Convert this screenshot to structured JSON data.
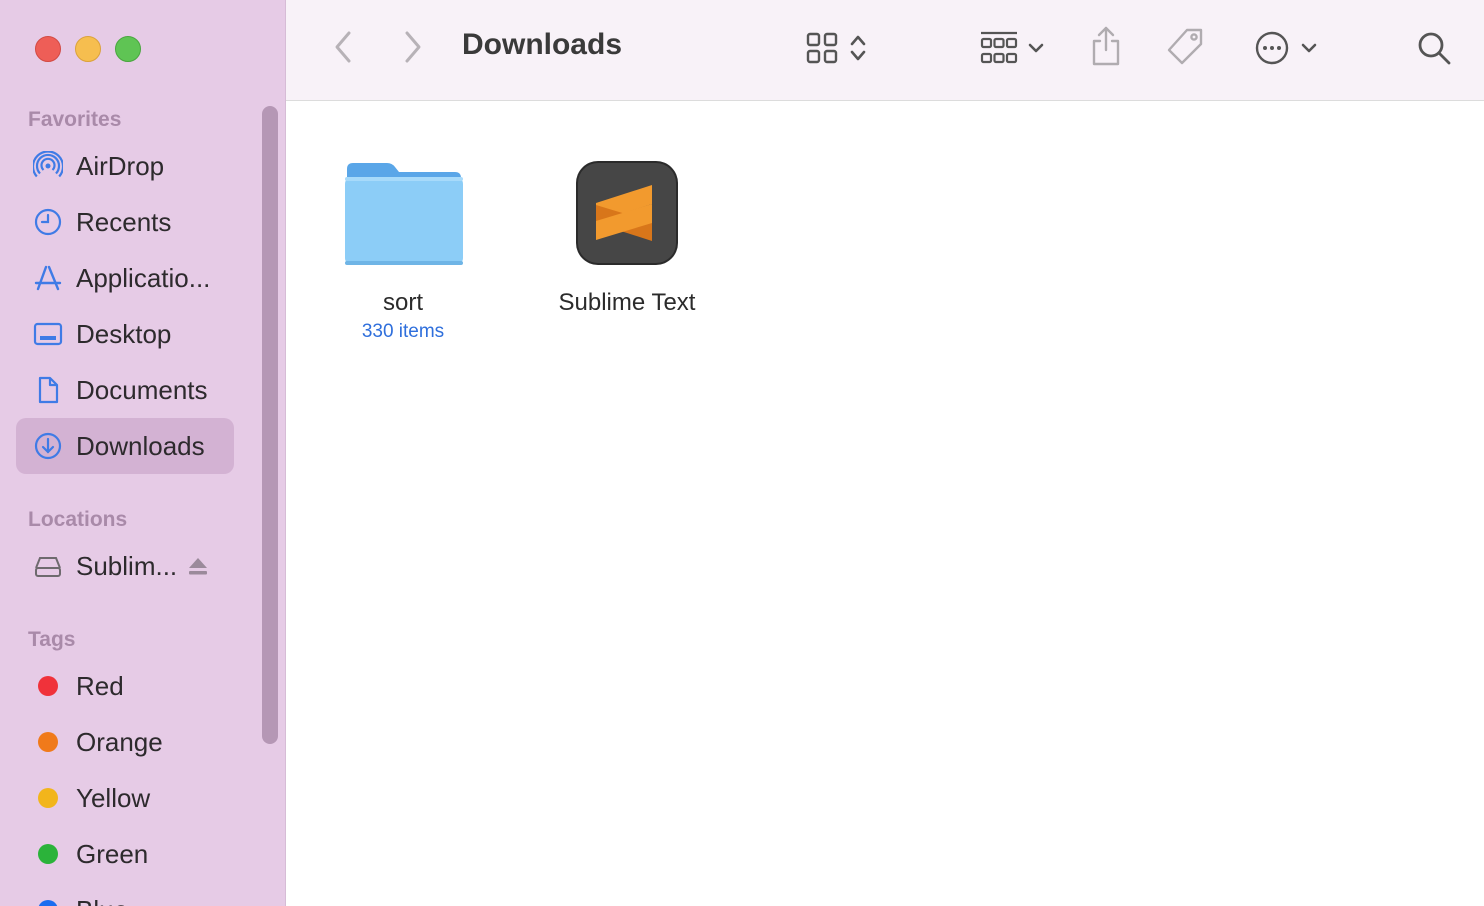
{
  "window": {
    "title": "Downloads"
  },
  "sidebar": {
    "favorites_title": "Favorites",
    "favorites": [
      {
        "label": "AirDrop",
        "icon": "airdrop-icon"
      },
      {
        "label": "Recents",
        "icon": "clock-icon"
      },
      {
        "label": "Applicatio...",
        "icon": "applications-icon"
      },
      {
        "label": "Desktop",
        "icon": "desktop-icon"
      },
      {
        "label": "Documents",
        "icon": "document-icon"
      },
      {
        "label": "Downloads",
        "icon": "download-icon",
        "active": true
      }
    ],
    "locations_title": "Locations",
    "locations": [
      {
        "label": "Sublim...",
        "icon": "drive-icon"
      }
    ],
    "tags_title": "Tags",
    "tags": [
      {
        "label": "Red",
        "color": "#f0323a"
      },
      {
        "label": "Orange",
        "color": "#f07a1a"
      },
      {
        "label": "Yellow",
        "color": "#f2b51b"
      },
      {
        "label": "Green",
        "color": "#2bb33a"
      },
      {
        "label": "Blue",
        "color": "#1b6df0"
      }
    ]
  },
  "files": [
    {
      "name": "sort",
      "sub": "330 items",
      "icon": "folder-icon"
    },
    {
      "name": "Sublime Text",
      "sub": "",
      "icon": "sublime-text-app-icon"
    }
  ],
  "colors": {
    "sidebar_bg": "#e6cbe6",
    "accent_blue": "#2f6fdc",
    "sublime_orange": "#f29a2e"
  }
}
